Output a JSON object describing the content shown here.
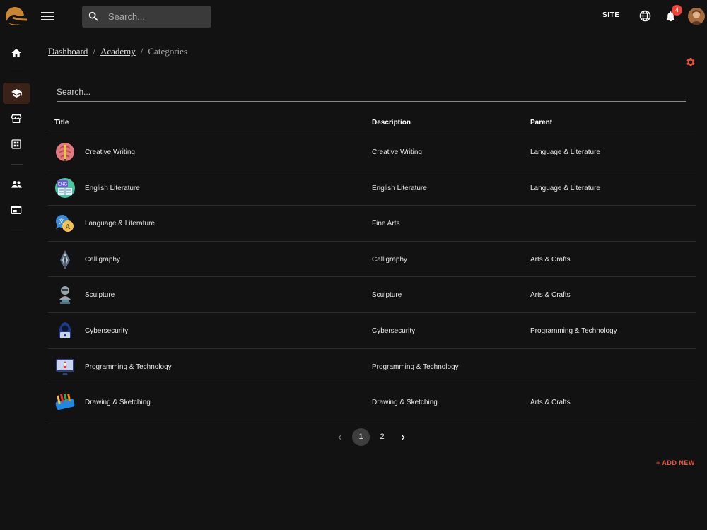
{
  "topbar": {
    "search_placeholder": "Search...",
    "site_label": "SITE",
    "notification_count": "4"
  },
  "breadcrumb": {
    "items": [
      "Dashboard",
      "Academy",
      "Categories"
    ],
    "separator": "/"
  },
  "filter": {
    "placeholder": "Search..."
  },
  "table": {
    "headers": [
      "Title",
      "Description",
      "Parent"
    ],
    "rows": [
      {
        "title": "Creative Writing",
        "description": "Creative Writing",
        "parent": "Language & Literature",
        "icon": "brain-pen-icon"
      },
      {
        "title": "English Literature",
        "description": "English Literature",
        "parent": "Language & Literature",
        "icon": "english-book-icon"
      },
      {
        "title": "Language & Literature",
        "description": "Fine Arts",
        "parent": "",
        "icon": "speech-bubbles-icon"
      },
      {
        "title": "Calligraphy",
        "description": "Calligraphy",
        "parent": "Arts & Crafts",
        "icon": "fountain-pen-icon"
      },
      {
        "title": "Sculpture",
        "description": "Sculpture",
        "parent": "Arts & Crafts",
        "icon": "bust-sculpture-icon"
      },
      {
        "title": "Cybersecurity",
        "description": "Cybersecurity",
        "parent": "Programming & Technology",
        "icon": "hacker-icon"
      },
      {
        "title": "Programming & Technology",
        "description": "Programming & Technology",
        "parent": "",
        "icon": "rocket-monitor-icon"
      },
      {
        "title": "Drawing & Sketching",
        "description": "Drawing & Sketching",
        "parent": "Arts & Crafts",
        "icon": "pencil-case-icon"
      }
    ]
  },
  "pagination": {
    "pages": [
      "1",
      "2"
    ],
    "current": "1"
  },
  "actions": {
    "add_new": "+ ADD NEW"
  },
  "colors": {
    "accent": "#e8553a",
    "background": "#121212",
    "search_bg": "#3a3a3a",
    "badge": "#f44336"
  }
}
